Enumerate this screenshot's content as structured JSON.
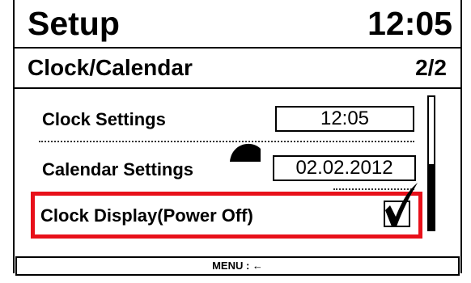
{
  "header": {
    "title": "Setup",
    "time": "12:05"
  },
  "subheader": {
    "title": "Clock/Calendar",
    "page": "2/2"
  },
  "rows": [
    {
      "label": "Clock Settings",
      "value": "12:05"
    },
    {
      "label": "Calendar Settings",
      "value": "02.02.2012"
    },
    {
      "label": "Clock Display(Power Off)",
      "checked": true
    }
  ],
  "scroll": {
    "position_fraction": 0.5
  },
  "footer": {
    "label": "MENU : ←"
  },
  "colors": {
    "highlight": "#e8101a",
    "text": "#000000",
    "background": "#ffffff"
  },
  "icons": {
    "checkmark": "checkmark-icon"
  }
}
